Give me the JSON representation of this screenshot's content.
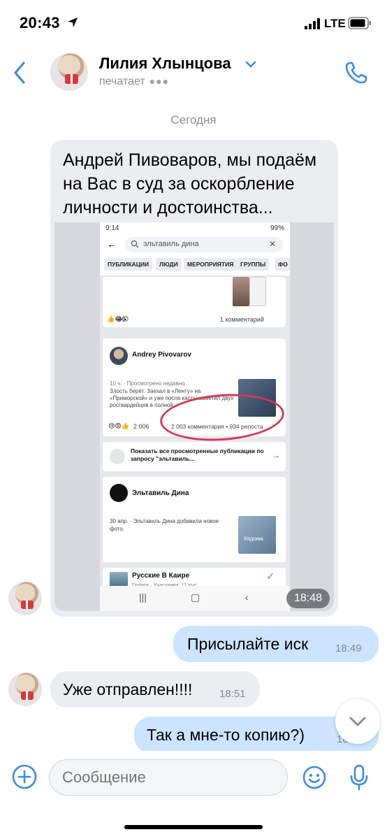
{
  "status_bar": {
    "time": "20:43",
    "network": "LTE"
  },
  "header": {
    "contact_name": "Лилия Хлынцова",
    "status": "печатает",
    "typing_dots": "●●●"
  },
  "date_separator": "Сегодня",
  "messages": {
    "incoming_1": {
      "text": "Андрей Пивоваров, мы подаём на Вас в суд за оскорбление личности и достоинства...",
      "time": "18:48",
      "screenshot": {
        "status_time": "9:14",
        "status_right": "99%",
        "search_query": "эльтавиль дина",
        "filters": [
          "ПУБЛИКАЦИИ",
          "ЛЮДИ",
          "МЕРОПРИЯТИЯ",
          "ГРУППЫ",
          "ФО"
        ],
        "card1_reactions": "90",
        "card1_comments": "1 комментарий",
        "post_author": "Andrey Pivovarov",
        "post_meta": "10 ч. · Просмотрено недавно",
        "post_text": "Злость берёт. Заехал в «Ленту» на «Приморской» и уже после кассы заметил двух росгвардейцев в полной...",
        "post_reactions": "2 006",
        "post_stats": "2 003 комментария • 934 репоста",
        "show_all": "Показать все просмотренные публикации по запросу \"эльтавиль...",
        "user2_name": "Эльтавиль Дина",
        "user2_meta": "30 апр. · Эльтавиль Дина добавила новое фото.",
        "photo_tag": "#ядома",
        "group_name": "Русские В Каире",
        "group_meta": "Группа · Участники: 11 тыс."
      }
    },
    "outgoing_1": {
      "text": "Присылайте иск",
      "time": "18:49"
    },
    "incoming_2": {
      "text": "Уже отправлен!!!!",
      "time": "18:51"
    },
    "outgoing_2": {
      "text": "Так а мне-то копию?)",
      "time": "18:5"
    }
  },
  "composer": {
    "placeholder": "Сообщение"
  },
  "colors": {
    "accent": "#3f8ae0",
    "outgoing_bubble": "#cce4ff",
    "incoming_bubble": "#ecedf0"
  }
}
